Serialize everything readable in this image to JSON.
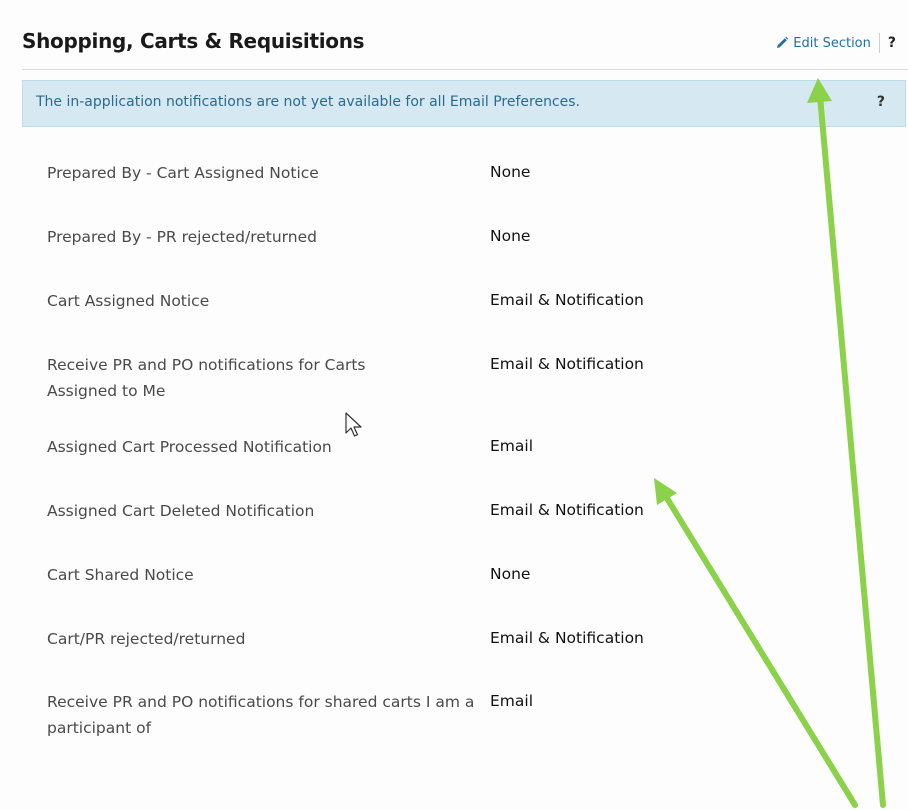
{
  "header": {
    "title": "Shopping, Carts & Requisitions",
    "edit_label": "Edit Section",
    "help_label": "?"
  },
  "info_bar": {
    "text": "The in-application notifications are not yet available for all Email Preferences.",
    "help_label": "?"
  },
  "preferences": [
    {
      "label": "Prepared By - Cart Assigned Notice",
      "value": "None"
    },
    {
      "label": "Prepared By - PR rejected/returned",
      "value": "None"
    },
    {
      "label": "Cart Assigned Notice",
      "value": "Email & Notification"
    },
    {
      "label": "Receive PR and PO notifications for Carts Assigned to Me",
      "value": "Email & Notification"
    },
    {
      "label": "Assigned Cart Processed Notification",
      "value": "Email"
    },
    {
      "label": "Assigned Cart Deleted Notification",
      "value": "Email & Notification"
    },
    {
      "label": "Cart Shared Notice",
      "value": "None"
    },
    {
      "label": "Cart/PR rejected/returned",
      "value": "Email & Notification"
    },
    {
      "label": "Receive PR and PO notifications for shared carts I am a participant of",
      "value": "Email"
    }
  ],
  "colors": {
    "accent": "#1f6fa8",
    "info_bg": "#d6e9f3",
    "annotation_arrow": "#8bd14a"
  },
  "icons": {
    "edit": "pencil-icon",
    "pointer": "mouse-cursor-icon"
  }
}
